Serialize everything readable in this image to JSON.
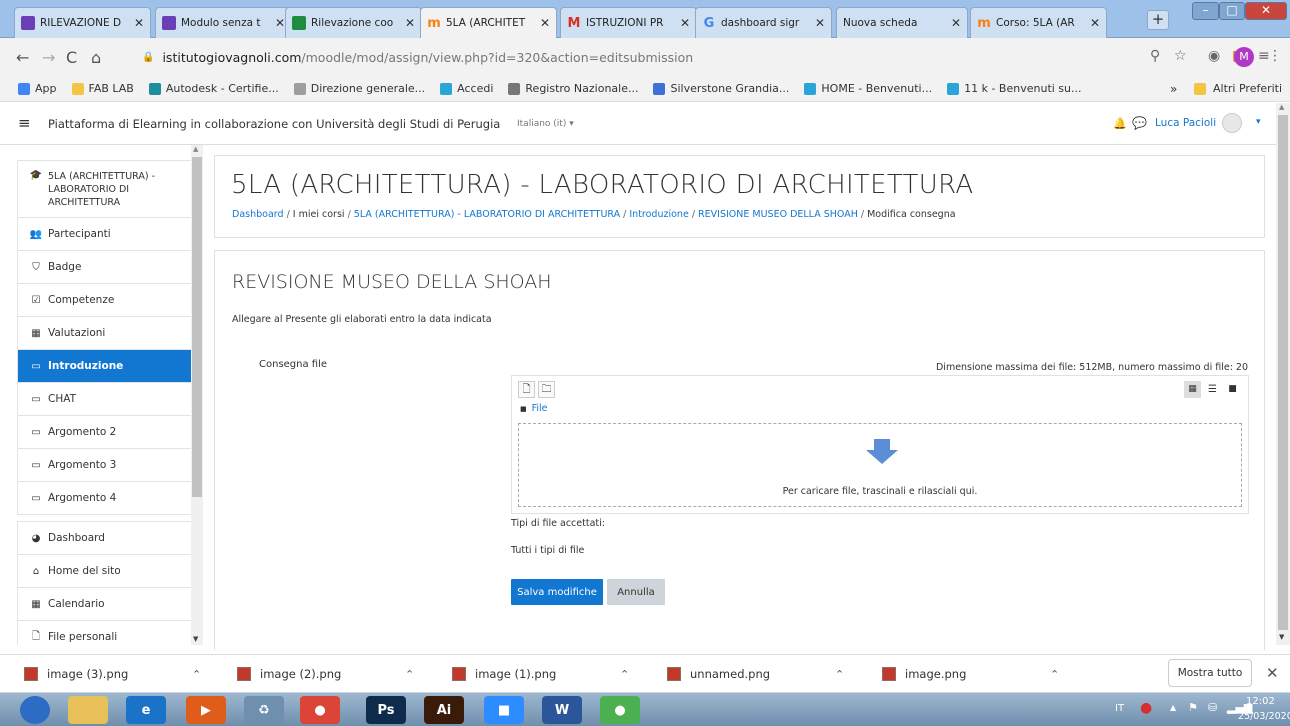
{
  "browser": {
    "tabs": [
      {
        "label": "RILEVAZIONE D",
        "icon": "forms-icon",
        "color": "#6a3fb5"
      },
      {
        "label": "Modulo senza t",
        "icon": "forms-icon",
        "color": "#6a3fb5"
      },
      {
        "label": "Rilevazione coo",
        "icon": "sheets-icon",
        "color": "#1e8e3e"
      },
      {
        "label": "5LA (ARCHITET",
        "icon": "moodle-icon",
        "color": "#f98012",
        "active": true
      },
      {
        "label": "ISTRUZIONI PR",
        "icon": "gmail-icon",
        "color": "#d93025"
      },
      {
        "label": "dashboard sigr",
        "icon": "google-icon",
        "color": "#4285f4"
      },
      {
        "label": "Nuova scheda",
        "icon": "blank-icon",
        "color": "#999999"
      },
      {
        "label": "Corso: 5LA (AR",
        "icon": "moodle-icon",
        "color": "#f98012"
      }
    ],
    "url_host": "istitutogiovagnoli.com",
    "url_path": "/moodle/mod/assign/view.php?id=320&action=editsubmission",
    "profile_initial": "M",
    "bookmarks": [
      {
        "label": "App",
        "icon": "apps-icon",
        "color": "#4285f4"
      },
      {
        "label": "FAB LAB",
        "icon": "folder-icon",
        "color": "#f4c542"
      },
      {
        "label": "Autodesk - Certifie...",
        "icon": "autodesk-icon",
        "color": "#1e8e9e"
      },
      {
        "label": "Direzione generale...",
        "icon": "globe-icon",
        "color": "#9e9e9e"
      },
      {
        "label": "Accedi",
        "icon": "office-icon",
        "color": "#2aa5d8"
      },
      {
        "label": "Registro Nazionale...",
        "icon": "registry-icon",
        "color": "#777777"
      },
      {
        "label": "Silverstone Grandia...",
        "icon": "silverstone-icon",
        "color": "#3f6fd8"
      },
      {
        "label": "HOME - Benvenuti...",
        "icon": "office-icon",
        "color": "#2aa5d8"
      },
      {
        "label": "11 k - Benvenuti su...",
        "icon": "office-icon",
        "color": "#2aa5d8"
      }
    ],
    "bookmarks_more": "»",
    "other_bookmarks": "Altri Preferiti"
  },
  "moodle": {
    "platform_title": "Piattaforma di Elearning in collaborazione con Università degli Studi di Perugia",
    "language": "Italiano (it) ▾",
    "user_name": "Luca Pacioli",
    "sidebar_groups": [
      [
        {
          "label": "5LA (ARCHITETTURA) - LABORATORIO DI ARCHITETTURA",
          "icon": "graduation-cap-icon"
        },
        {
          "label": "Partecipanti",
          "icon": "users-icon"
        },
        {
          "label": "Badge",
          "icon": "shield-icon"
        },
        {
          "label": "Competenze",
          "icon": "checkbox-icon"
        },
        {
          "label": "Valutazioni",
          "icon": "table-icon"
        },
        {
          "label": "Introduzione",
          "icon": "folder-icon",
          "active": true
        },
        {
          "label": "CHAT",
          "icon": "folder-icon"
        },
        {
          "label": "Argomento 2",
          "icon": "folder-icon"
        },
        {
          "label": "Argomento 3",
          "icon": "folder-icon"
        },
        {
          "label": "Argomento 4",
          "icon": "folder-icon"
        }
      ],
      [
        {
          "label": "Dashboard",
          "icon": "dashboard-icon"
        },
        {
          "label": "Home del sito",
          "icon": "home-icon"
        },
        {
          "label": "Calendario",
          "icon": "calendar-icon"
        },
        {
          "label": "File personali",
          "icon": "file-icon"
        }
      ]
    ],
    "course_title": "5LA (ARCHITETTURA) - LABORATORIO DI ARCHITETTURA",
    "breadcrumb": [
      {
        "label": "Dashboard",
        "link": true
      },
      {
        "label": "I miei corsi",
        "link": false
      },
      {
        "label": "5LA (ARCHITETTURA) - LABORATORIO DI ARCHITETTURA",
        "link": true
      },
      {
        "label": "Introduzione",
        "link": true
      },
      {
        "label": "REVISIONE MUSEO DELLA SHOAH",
        "link": true
      },
      {
        "label": "Modifica consegna",
        "link": false
      }
    ],
    "assignment_title": "REVISIONE MUSEO DELLA SHOAH",
    "description": "Allegare al Presente gli elaborati entro la data indicata",
    "field_label": "Consegna file",
    "max_size": "Dimensione massima dei file: 512MB, numero massimo di file: 20",
    "file_path": "File",
    "drop_hint": "Per caricare file, trascinali e rilasciali qui.",
    "accepted_label": "Tipi di file accettati:",
    "accepted_value": "Tutti i tipi di file",
    "save_button": "Salva modifiche",
    "cancel_button": "Annulla"
  },
  "downloads": {
    "items": [
      "image (3).png",
      "image (2).png",
      "image (1).png",
      "unnamed.png",
      "image.png"
    ],
    "show_all": "Mostra tutto"
  },
  "taskbar": {
    "language": "IT",
    "time": "12:02",
    "date": "25/03/2020",
    "apps": [
      {
        "name": "windows-start-icon",
        "text": "",
        "color": "#2c6cc4"
      },
      {
        "name": "explorer-icon",
        "text": "",
        "color": "#e8c05a"
      },
      {
        "name": "internet-explorer-icon",
        "text": "e",
        "color": "#1a73c8"
      },
      {
        "name": "media-player-icon",
        "text": "▶",
        "color": "#e05c1a"
      },
      {
        "name": "recycle-icon",
        "text": "♻",
        "color": "#6f8fae"
      },
      {
        "name": "chrome-icon",
        "text": "●",
        "color": "#db4437"
      },
      {
        "name": "photoshop-icon",
        "text": "Ps",
        "color": "#0d2b4a"
      },
      {
        "name": "illustrator-icon",
        "text": "Ai",
        "color": "#3a1b0a"
      },
      {
        "name": "zoom-icon",
        "text": "■",
        "color": "#2d8cff"
      },
      {
        "name": "word-icon",
        "text": "W",
        "color": "#2b579a"
      },
      {
        "name": "app-icon",
        "text": "●",
        "color": "#4caf50"
      }
    ]
  }
}
